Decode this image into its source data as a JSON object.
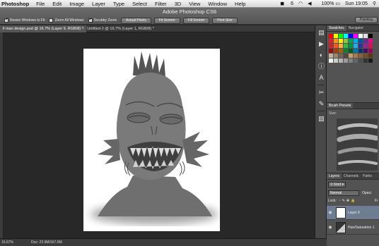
{
  "menubar": {
    "app_name": "Photoshop",
    "items": [
      "File",
      "Edit",
      "Image",
      "Layer",
      "Type",
      "Select",
      "Filter",
      "3D",
      "View",
      "Window",
      "Help"
    ],
    "status": {
      "adobe_badge": "6",
      "battery": "100%",
      "time": "Sun 19:05"
    }
  },
  "options_bar": {
    "window_title": "Adobe Photoshop CS6",
    "checks": [
      {
        "label": "Resize Windows to Fit",
        "checked": true
      },
      {
        "label": "Zoom All Windows",
        "checked": false
      },
      {
        "label": "Scrubby Zoom",
        "checked": true
      }
    ],
    "buttons": [
      "Actual Pixels",
      "Fit Screen",
      "Fill Screen",
      "Print Size"
    ],
    "workspace": "Painting"
  },
  "tabs": [
    {
      "label": "ll man design.psd @ 16.7% (Layer 9, RGB/8) *",
      "active": true
    },
    {
      "label": "Untitled-2 @ 16.7% (Layer 1, RGB/8) *",
      "active": false
    }
  ],
  "status_bar": {
    "zoom": "16.67%",
    "doc_size": "Doc: 22.9M/167.0M"
  },
  "panels": {
    "swatches_tabs": [
      "Swatches",
      "Navigator"
    ],
    "brush_title": "Brush Presets",
    "brush_size_label": "Size:",
    "layers_tabs": [
      "Layers",
      "Channels",
      "Paths"
    ],
    "kind_label": "Kind",
    "blend_mode": "Normal",
    "opacity_label": "Opaci",
    "lock_label": "Lock:",
    "fill_label": "Fi",
    "layers": [
      {
        "name": "Layer 9",
        "selected": true,
        "type": "pixel"
      },
      {
        "name": "Hue/Saturation 1",
        "selected": false,
        "type": "adjustment"
      }
    ]
  },
  "colors": {
    "canvas_bg": "#282828",
    "panel_bg": "#535353",
    "selected_layer": "#6f7d93"
  }
}
